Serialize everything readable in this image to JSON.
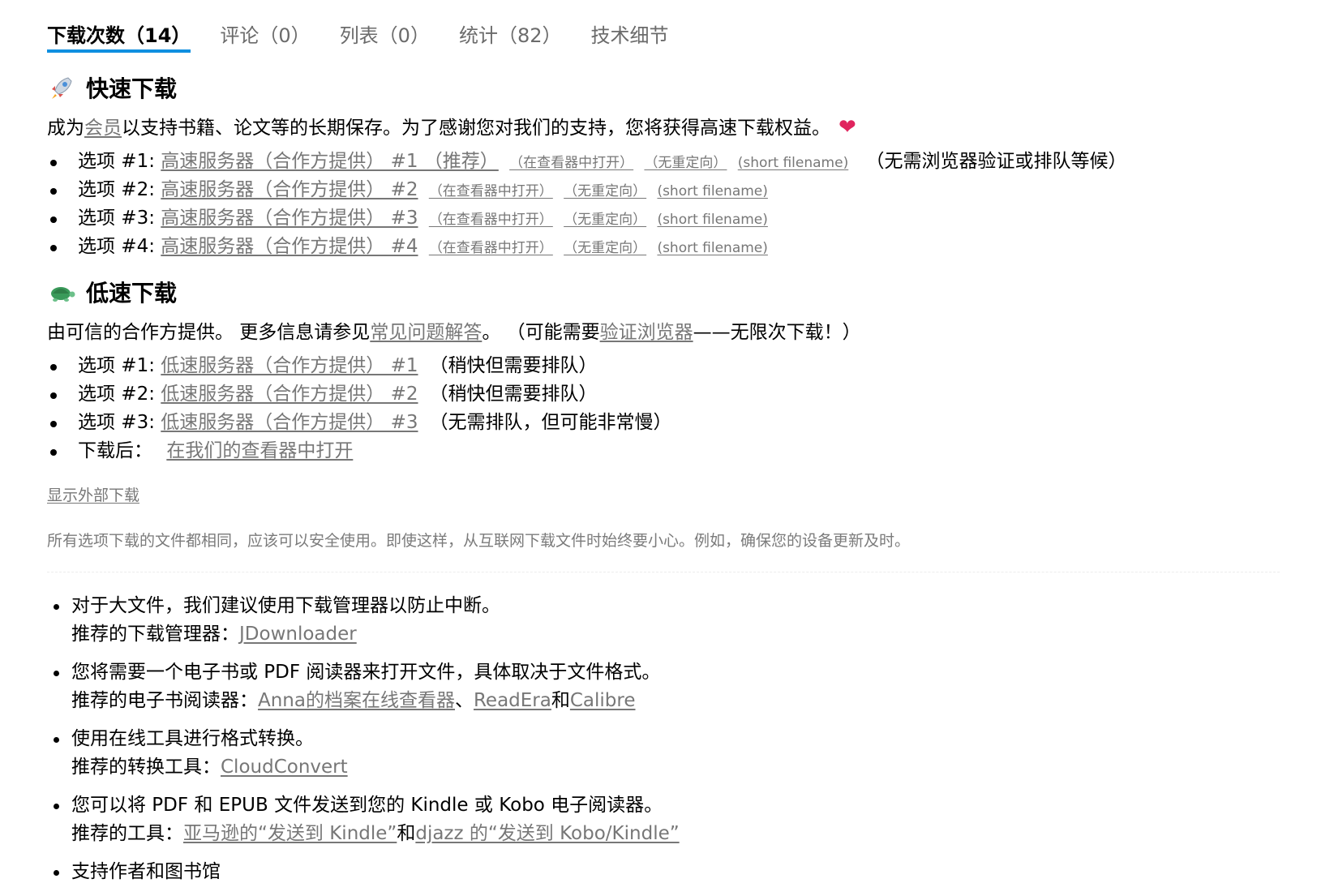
{
  "tabs": [
    {
      "label": "下载次数（14）",
      "active": true
    },
    {
      "label": "评论（0）",
      "active": false
    },
    {
      "label": "列表（0）",
      "active": false
    },
    {
      "label": "统计（82）",
      "active": false
    },
    {
      "label": "技术细节",
      "active": false
    }
  ],
  "fast": {
    "emoji_icon": "rocket-icon",
    "title": "快速下载",
    "intro_before": "成为",
    "intro_link": "会员",
    "intro_after": "以支持书籍、论文等的长期保存。为了感谢您对我们的支持，您将获得高速下载权益。",
    "heart_icon": "heart-icon",
    "heart_glyph": "❤",
    "options": [
      {
        "prefix": "选项 #1: ",
        "link": "高速服务器（合作方提供） #1 （推荐）",
        "viewer": "（在查看器中打开）",
        "noredirect": "（无重定向）",
        "short": "(short filename)",
        "note": "（无需浏览器验证或排队等候）"
      },
      {
        "prefix": "选项 #2: ",
        "link": "高速服务器（合作方提供） #2",
        "viewer": "（在查看器中打开）",
        "noredirect": "（无重定向）",
        "short": "(short filename)",
        "note": ""
      },
      {
        "prefix": "选项 #3: ",
        "link": "高速服务器（合作方提供） #3",
        "viewer": "（在查看器中打开）",
        "noredirect": "（无重定向）",
        "short": "(short filename)",
        "note": ""
      },
      {
        "prefix": "选项 #4: ",
        "link": "高速服务器（合作方提供） #4",
        "viewer": "（在查看器中打开）",
        "noredirect": "（无重定向）",
        "short": "(short filename)",
        "note": ""
      }
    ]
  },
  "slow": {
    "emoji_icon": "turtle-icon",
    "title": "低速下载",
    "intro_part1": "由可信的合作方提供。 更多信息请参见",
    "intro_link1": "常见问题解答",
    "intro_part2": "。 （可能需要",
    "intro_link2": "验证浏览器",
    "intro_part3": "——无限次下载！）",
    "options": [
      {
        "prefix": "选项 #1: ",
        "link": "低速服务器（合作方提供） #1",
        "note": "（稍快但需要排队）"
      },
      {
        "prefix": "选项 #2: ",
        "link": "低速服务器（合作方提供） #2",
        "note": "（稍快但需要排队）"
      },
      {
        "prefix": "选项 #3: ",
        "link": "低速服务器（合作方提供） #3",
        "note": "（无需排队，但可能非常慢）"
      }
    ],
    "after_label": "下载后：",
    "after_link": "在我们的查看器中打开"
  },
  "external_link": "显示外部下载",
  "disclaimer": "所有选项下载的文件都相同，应该可以安全使用。即使这样，从互联网下载文件时始终要小心。例如，确保您的设备更新及时。",
  "tips": {
    "t1_line1": "对于大文件，我们建议使用下载管理器以防止中断。",
    "t1_label": "推荐的下载管理器：",
    "t1_link": "JDownloader",
    "t2_line1": "您将需要一个电子书或 PDF 阅读器来打开文件，具体取决于文件格式。",
    "t2_label": "推荐的电子书阅读器：",
    "t2_link1": "Anna的档案在线查看器",
    "t2_sep1": "、",
    "t2_link2": "ReadEra",
    "t2_sep2": "和",
    "t2_link3": "Calibre",
    "t3_line1": "使用在线工具进行格式转换。",
    "t3_label": "推荐的转换工具：",
    "t3_link": "CloudConvert",
    "t4_line1": "您可以将 PDF 和 EPUB 文件发送到您的 Kindle 或 Kobo 电子阅读器。",
    "t4_label": "推荐的工具：",
    "t4_link1": "亚马逊的“发送到 Kindle”",
    "t4_sep": "和",
    "t4_link2": "djazz 的“发送到 Kobo/Kindle”",
    "t5_line1": "支持作者和图书馆"
  }
}
